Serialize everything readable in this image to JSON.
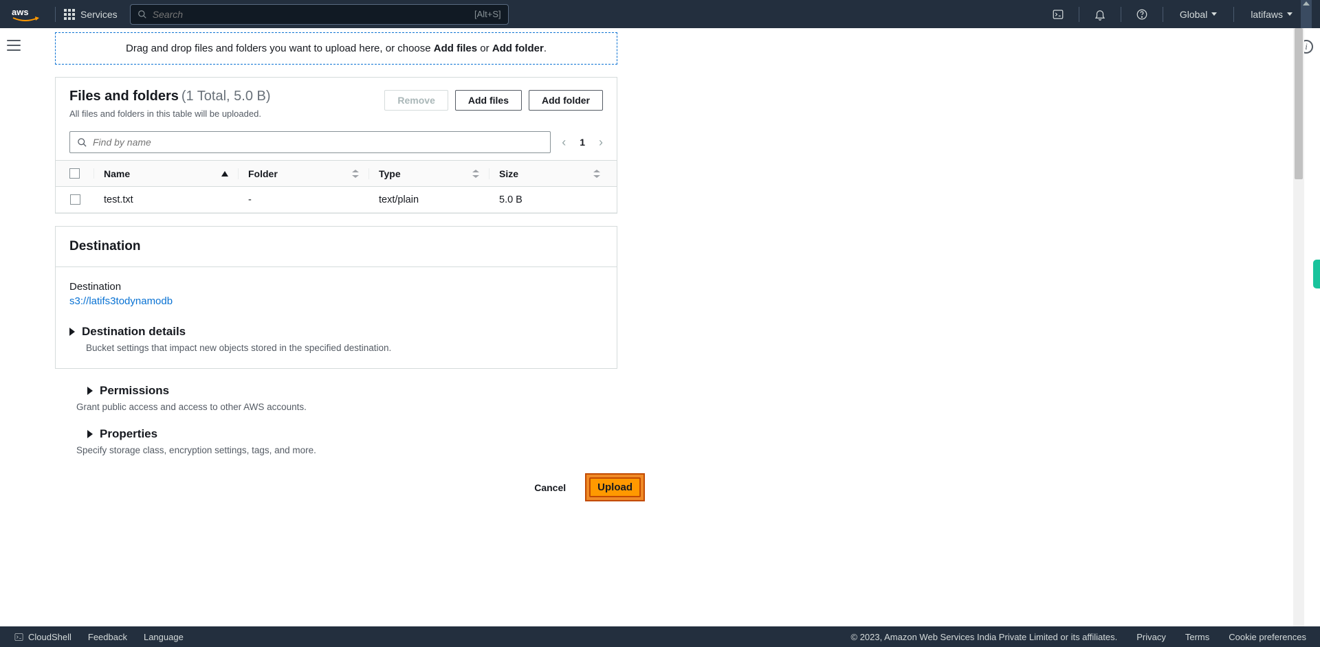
{
  "nav": {
    "services": "Services",
    "search_placeholder": "Search",
    "search_shortcut": "[Alt+S]",
    "region": "Global",
    "account": "latifaws"
  },
  "dropzone": {
    "prefix": "Drag and drop files and folders you want to upload here, or choose ",
    "add_files": "Add files",
    "or": " or ",
    "add_folder": "Add folder",
    "suffix": "."
  },
  "files": {
    "title": "Files and folders",
    "count": "(1 Total, 5.0 B)",
    "desc": "All files and folders in this table will be uploaded.",
    "remove": "Remove",
    "add_files": "Add files",
    "add_folder": "Add folder",
    "find_placeholder": "Find by name",
    "page": "1",
    "cols": {
      "name": "Name",
      "folder": "Folder",
      "type": "Type",
      "size": "Size"
    },
    "rows": [
      {
        "name": "test.txt",
        "folder": "-",
        "type": "text/plain",
        "size": "5.0 B"
      }
    ]
  },
  "destination": {
    "heading": "Destination",
    "label": "Destination",
    "link": "s3://latifs3todynamodb",
    "details_title": "Destination details",
    "details_desc": "Bucket settings that impact new objects stored in the specified destination."
  },
  "permissions": {
    "title": "Permissions",
    "desc": "Grant public access and access to other AWS accounts."
  },
  "properties": {
    "title": "Properties",
    "desc": "Specify storage class, encryption settings, tags, and more."
  },
  "actions": {
    "cancel": "Cancel",
    "upload": "Upload"
  },
  "footer": {
    "cloudshell": "CloudShell",
    "feedback": "Feedback",
    "language": "Language",
    "copyright": "© 2023, Amazon Web Services India Private Limited or its affiliates.",
    "privacy": "Privacy",
    "terms": "Terms",
    "cookies": "Cookie preferences"
  }
}
